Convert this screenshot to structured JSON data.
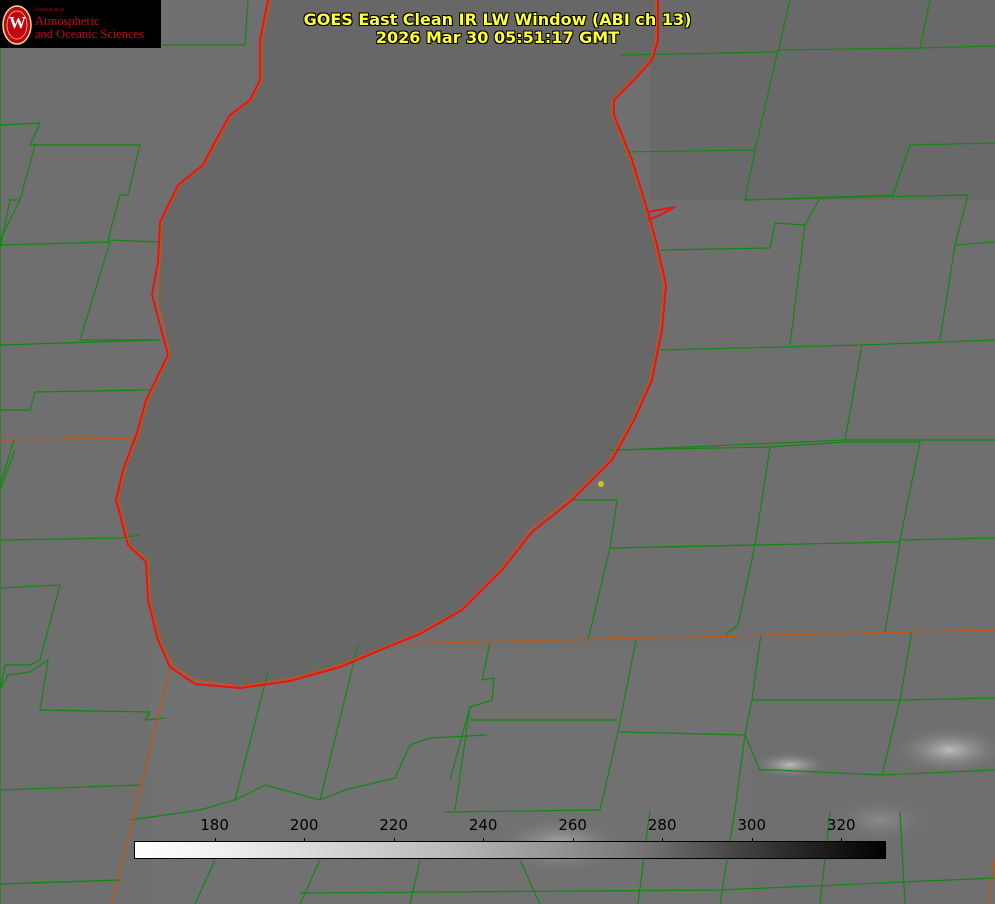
{
  "header": {
    "title_line1": "GOES East Clean IR LW Window (ABI ch 13)",
    "title_line2": "2026 Mar 30 05:51:17 GMT"
  },
  "logo": {
    "department": "Department of",
    "line1": "Atmospheric",
    "line2": "and Oceanic Sciences",
    "seal_letter": "W"
  },
  "colorbar": {
    "ticks": [
      "180",
      "200",
      "220",
      "240",
      "260",
      "280",
      "300",
      "320"
    ],
    "range": [
      162,
      330
    ],
    "gradient": "white-to-black"
  },
  "colors": {
    "lake_outline": "#ee1111",
    "county_lines": "#118811",
    "state_lines": "#b8581a",
    "title_text": "#ffff33",
    "brand_red": "#c5050c"
  },
  "map": {
    "marker": "yellow-dot"
  }
}
